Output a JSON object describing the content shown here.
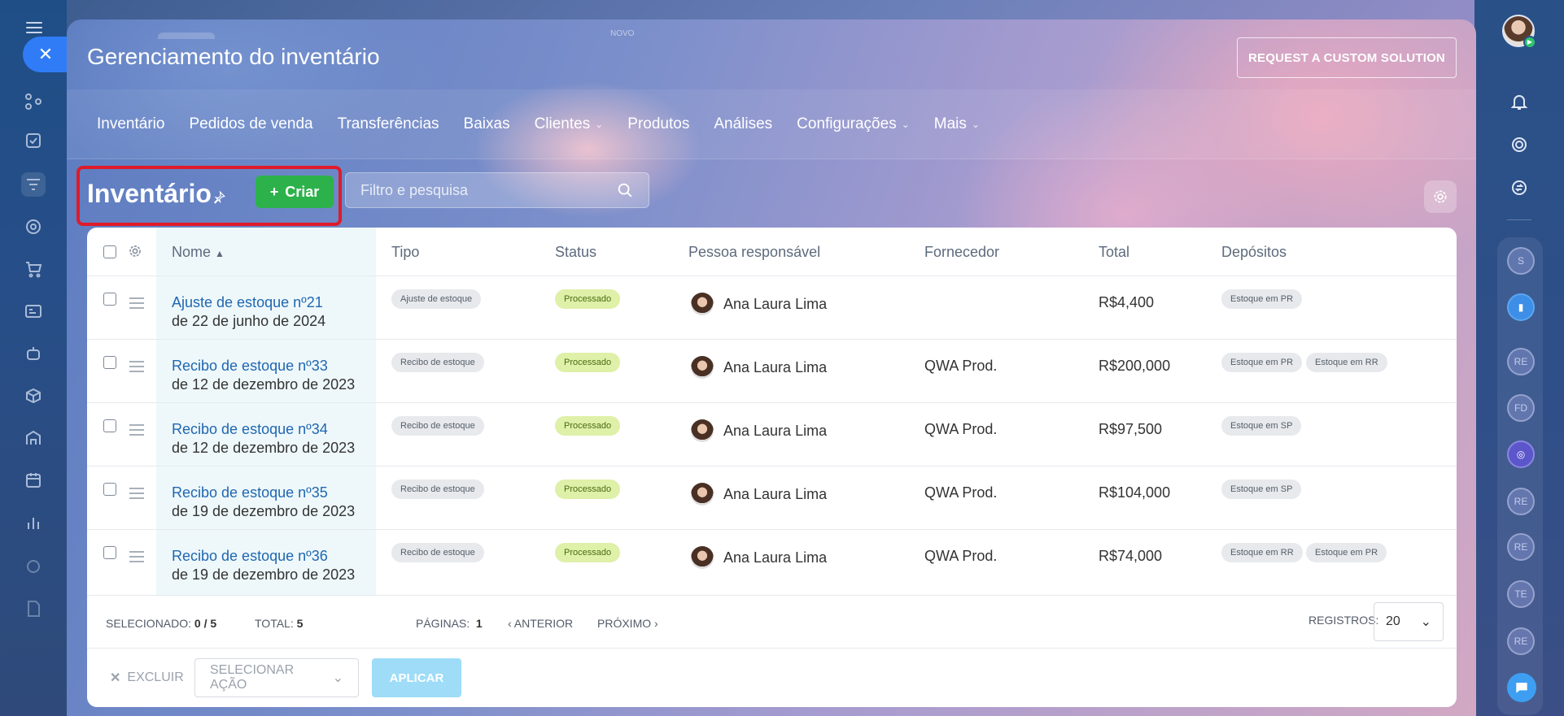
{
  "app": {
    "window_title": "Gerenciamento do inventário",
    "custom_solution_label": "REQUEST A CUSTOM SOLUTION",
    "ghost_tab_label": "NOVO"
  },
  "nav": {
    "items": [
      {
        "label": "Inventário",
        "dropdown": false
      },
      {
        "label": "Pedidos de venda",
        "dropdown": false
      },
      {
        "label": "Transferências",
        "dropdown": false
      },
      {
        "label": "Baixas",
        "dropdown": false
      },
      {
        "label": "Clientes",
        "dropdown": true
      },
      {
        "label": "Produtos",
        "dropdown": false
      },
      {
        "label": "Análises",
        "dropdown": false
      },
      {
        "label": "Configurações",
        "dropdown": true
      },
      {
        "label": "Mais",
        "dropdown": true
      }
    ]
  },
  "toolbar": {
    "page_title": "Inventário",
    "create_label": "Criar",
    "search_placeholder": "Filtro e pesquisa"
  },
  "table": {
    "headers": {
      "name": "Nome",
      "type": "Tipo",
      "status": "Status",
      "responsible": "Pessoa responsável",
      "supplier": "Fornecedor",
      "total": "Total",
      "warehouses": "Depósitos"
    },
    "rows": [
      {
        "name": "Ajuste de estoque nº21",
        "date": "de 22 de junho de 2024",
        "type": "Ajuste de estoque",
        "status": "Processado",
        "responsible": "Ana Laura Lima",
        "supplier": "",
        "total": "R$4,400",
        "warehouses": [
          "Estoque em PR"
        ]
      },
      {
        "name": "Recibo de estoque nº33",
        "date": "de 12 de dezembro de 2023",
        "type": "Recibo de estoque",
        "status": "Processado",
        "responsible": "Ana Laura Lima",
        "supplier": "QWA Prod.",
        "total": "R$200,000",
        "warehouses": [
          "Estoque em PR",
          "Estoque em RR"
        ]
      },
      {
        "name": "Recibo de estoque nº34",
        "date": "de 12 de dezembro de 2023",
        "type": "Recibo de estoque",
        "status": "Processado",
        "responsible": "Ana Laura Lima",
        "supplier": "QWA Prod.",
        "total": "R$97,500",
        "warehouses": [
          "Estoque em SP"
        ]
      },
      {
        "name": "Recibo de estoque nº35",
        "date": "de 19 de dezembro de 2023",
        "type": "Recibo de estoque",
        "status": "Processado",
        "responsible": "Ana Laura Lima",
        "supplier": "QWA Prod.",
        "total": "R$104,000",
        "warehouses": [
          "Estoque em SP"
        ]
      },
      {
        "name": "Recibo de estoque nº36",
        "date": "de 19 de dezembro de 2023",
        "type": "Recibo de estoque",
        "status": "Processado",
        "responsible": "Ana Laura Lima",
        "supplier": "QWA Prod.",
        "total": "R$74,000",
        "warehouses": [
          "Estoque em RR",
          "Estoque em PR"
        ]
      }
    ]
  },
  "footer": {
    "selected_label": "SELECIONADO:",
    "selected_value": "0 / 5",
    "total_label": "TOTAL:",
    "total_value": "5",
    "pages_label": "PÁGINAS:",
    "pages_value": "1",
    "prev_label": "ANTERIOR",
    "next_label": "PRÓXIMO",
    "records_label": "REGISTROS:",
    "records_value": "20"
  },
  "actions": {
    "delete_label": "EXCLUIR",
    "select_action_label": "SELECIONAR AÇÃO",
    "apply_label": "APLICAR"
  },
  "right_bar": {
    "avatars": [
      "S",
      "",
      "RE",
      "FD",
      "",
      "RE",
      "RE",
      "TE",
      "RE"
    ]
  },
  "colors": {
    "accent_blue": "#2f7cf6",
    "create_green": "#2db24b",
    "highlight_red": "#e01a2a",
    "link_blue": "#2067b0",
    "status_green_bg": "#dff0a8"
  }
}
